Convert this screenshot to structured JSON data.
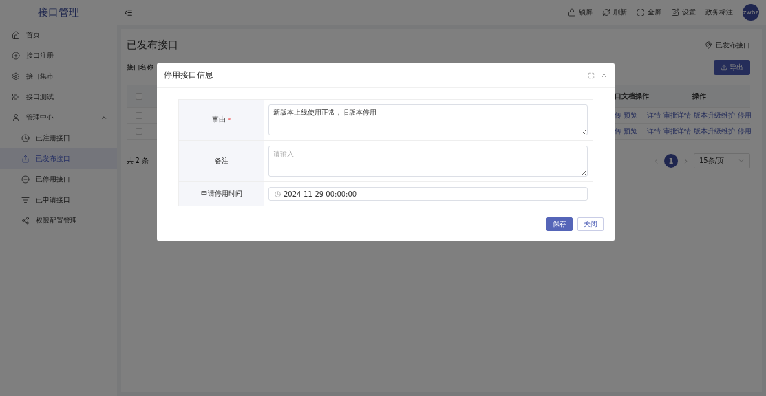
{
  "sidebar": {
    "title": "接口管理",
    "items": [
      {
        "label": "首页",
        "selected": false
      },
      {
        "label": "接口注册",
        "selected": false
      },
      {
        "label": "接口集市",
        "selected": false
      },
      {
        "label": "接口测试",
        "selected": false
      },
      {
        "label": "管理中心",
        "selected": false,
        "expanded": true,
        "children": [
          {
            "label": "已注册接口",
            "selected": false
          },
          {
            "label": "已发布接口",
            "selected": true
          },
          {
            "label": "已停用接口",
            "selected": false
          },
          {
            "label": "已申请接口",
            "selected": false
          },
          {
            "label": "权限配置管理",
            "selected": false
          }
        ]
      }
    ]
  },
  "header": {
    "actions": [
      "锁屏",
      "刷新",
      "全屏",
      "设置",
      "政务标注"
    ],
    "avatar": "zwbz"
  },
  "page": {
    "title": "已发布接口",
    "breadcrumb": "已发布接口",
    "filter_label": "接口名称",
    "export_button": "导出",
    "table": {
      "select_all_checked": false,
      "columns": [
        "口文档操作",
        "操作"
      ],
      "rows": [
        {
          "checked": false,
          "doc_ops": "传 预览",
          "actions": [
            "详情",
            "审批详情",
            "版本升级维护",
            "停用"
          ]
        },
        {
          "checked": false,
          "doc_ops": "传 预览",
          "actions": [
            "详情",
            "审批详情",
            "版本升级维护",
            "停用"
          ]
        }
      ]
    },
    "total": "共 2 条",
    "pages": [
      {
        "label": "1",
        "selected": true
      }
    ],
    "page_size": "15条/页"
  },
  "modal": {
    "title": "停用接口信息",
    "fields": [
      {
        "kind": "textarea",
        "label": "事由",
        "required_mark": "*",
        "value": "新版本上线使用正常，旧版本停用"
      },
      {
        "kind": "textarea",
        "label": "备注",
        "placeholder": "请输入"
      },
      {
        "kind": "datetime",
        "label": "申请停用时间",
        "value": "2024-11-29 00:00:00"
      }
    ],
    "buttons": [
      {
        "label": "保存",
        "kind": "primary"
      },
      {
        "label": "关闭",
        "kind": "default"
      }
    ]
  }
}
